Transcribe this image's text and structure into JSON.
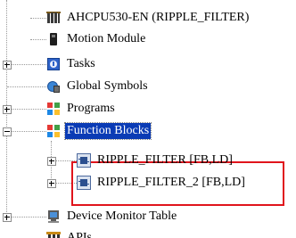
{
  "tree": {
    "items": [
      {
        "label": "AHCPU530-EN  (RIPPLE_FILTER)",
        "icon": "cpu-icon",
        "expander": "none",
        "selected": false
      },
      {
        "label": "Motion Module",
        "icon": "motion-module-icon",
        "expander": "none",
        "selected": false
      },
      {
        "label": "Tasks",
        "icon": "tasks-icon",
        "expander": "collapsed",
        "selected": false
      },
      {
        "label": "Global Symbols",
        "icon": "global-symbols-icon",
        "expander": "none",
        "selected": false
      },
      {
        "label": "Programs",
        "icon": "programs-icon",
        "expander": "collapsed",
        "selected": false
      },
      {
        "label": "Function Blocks",
        "icon": "function-blocks-icon",
        "expander": "expanded",
        "selected": true
      },
      {
        "label": "RIPPLE_FILTER [FB,LD]",
        "icon": "function-block-icon",
        "expander": "collapsed",
        "selected": false
      },
      {
        "label": "RIPPLE_FILTER_2 [FB,LD]",
        "icon": "function-block-icon",
        "expander": "collapsed",
        "selected": false
      },
      {
        "label": "Device Monitor Table",
        "icon": "device-monitor-icon",
        "expander": "collapsed",
        "selected": false
      },
      {
        "label": "APIs",
        "icon": "apis-icon",
        "expander": "collapsed",
        "selected": false
      }
    ]
  },
  "colors": {
    "selection_bg": "#0a3bb5",
    "highlight_border": "#e0141c"
  }
}
